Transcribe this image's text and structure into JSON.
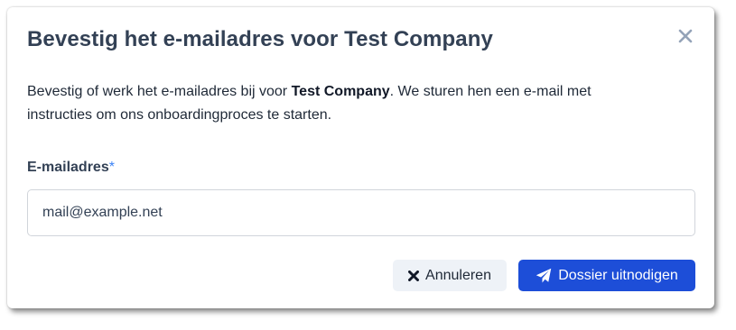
{
  "dialog": {
    "title": "Bevestig het e-mailadres voor Test Company",
    "description": {
      "before": "Bevestig of werk het e-mailadres bij voor ",
      "company": "Test Company",
      "after": ". We sturen hen een e-mail met instructies om ons onboardingproces te starten."
    },
    "close_icon": "close-icon"
  },
  "form": {
    "email_label": "E-mailadres",
    "required_marker": "*",
    "email_value": "mail@example.net"
  },
  "actions": {
    "cancel_label": "Annuleren",
    "cancel_icon": "times-icon",
    "submit_label": "Dossier uitnodigen",
    "submit_icon": "paper-plane-icon"
  },
  "colors": {
    "primary": "#1d4ed8",
    "title": "#334155",
    "required": "#3b82f6",
    "cancel_bg": "#eef2f7"
  }
}
